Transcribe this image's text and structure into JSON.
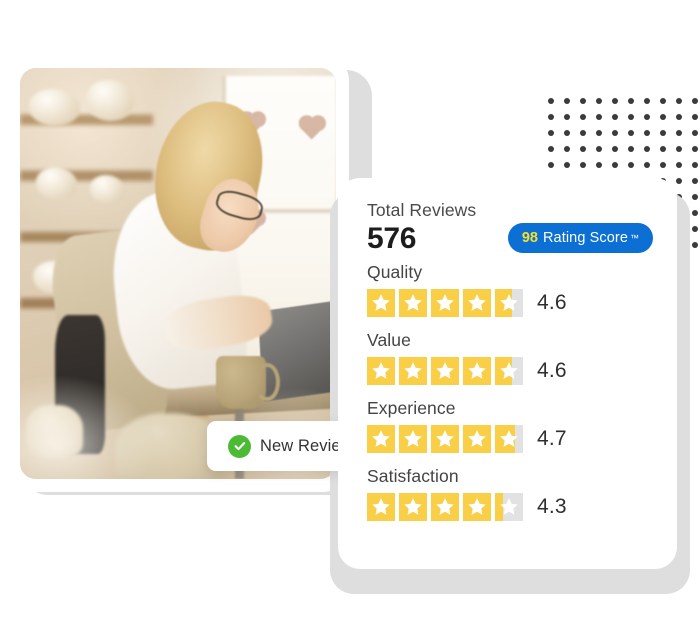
{
  "photo": {
    "alt": "woman-in-apron-holding-ceramic-mug-at-laptop-in-pottery-studio"
  },
  "toast": {
    "label": "New Review",
    "icon": "check-circle-icon",
    "icon_color": "#4CBB34"
  },
  "review_card": {
    "total_reviews_label": "Total Reviews",
    "total_reviews_value": "576",
    "score_badge": {
      "score": "98",
      "text": "Rating Score",
      "trademark": "™",
      "background_color": "#0b6fd4",
      "score_color": "#F7E02E",
      "text_color": "#ffffff"
    },
    "star_colors": {
      "filled": "#F9CF47",
      "empty": "#E2E2E2",
      "glyph": "#ffffff"
    },
    "ratings": [
      {
        "name": "Quality",
        "value": "4.6",
        "stars": 4.6
      },
      {
        "name": "Value",
        "value": "4.6",
        "stars": 4.6
      },
      {
        "name": "Experience",
        "value": "4.7",
        "stars": 4.7
      },
      {
        "name": "Satisfaction",
        "value": "4.3",
        "stars": 4.3
      }
    ]
  },
  "decor": {
    "dot_grid": {
      "columns": 10,
      "rows": 10,
      "dot_color": "#3b3b3b"
    },
    "backing_card_color": "#dedede"
  }
}
